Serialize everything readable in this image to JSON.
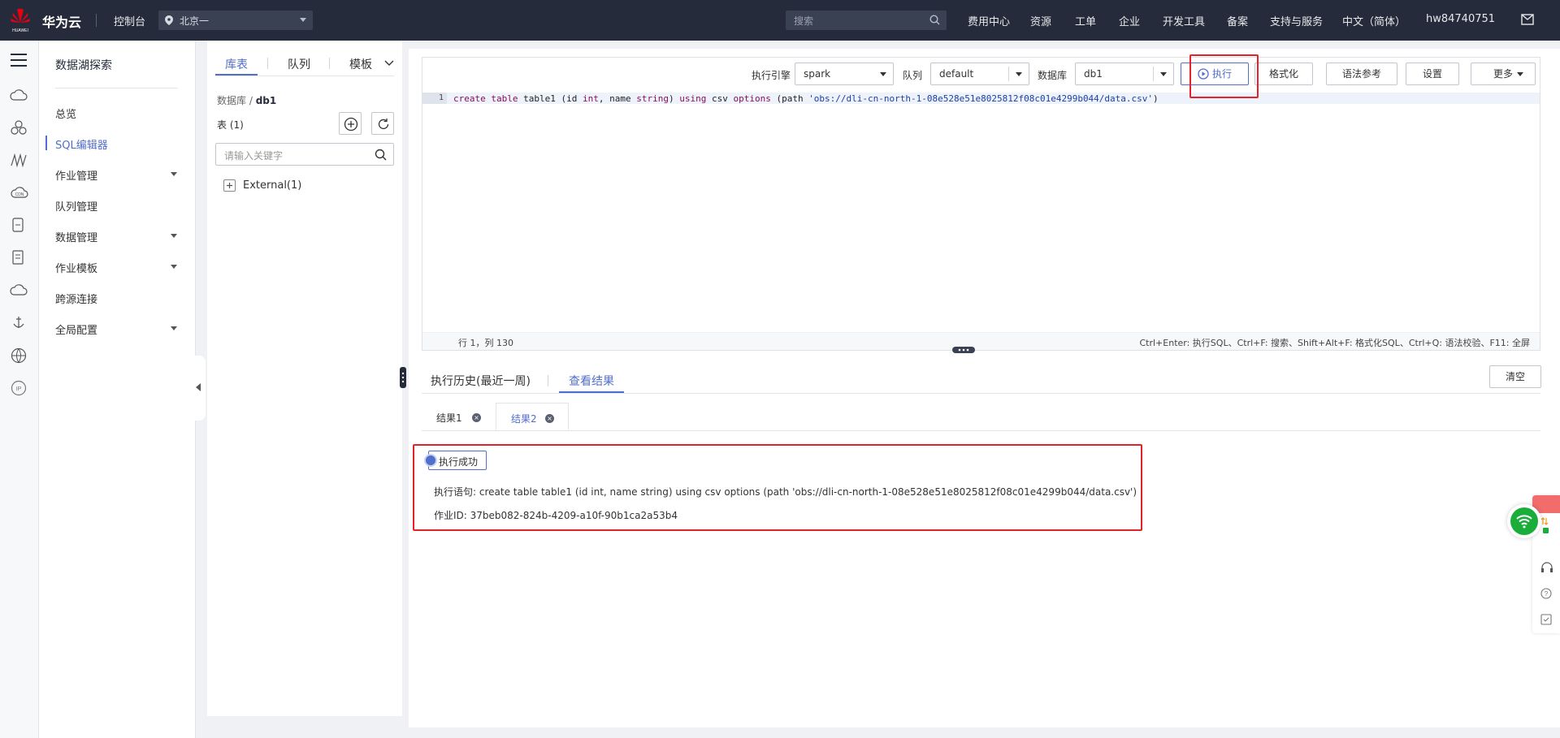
{
  "topbar": {
    "brand": "华为云",
    "console": "控制台",
    "region": "北京一",
    "search_placeholder": "搜索",
    "nav": [
      "费用中心",
      "资源",
      "工单",
      "企业",
      "开发工具",
      "备案",
      "支持与服务",
      "中文（简体）",
      "hw84740751"
    ]
  },
  "menu": {
    "title": "数据湖探索",
    "items": [
      {
        "label": "总览"
      },
      {
        "label": "SQL编辑器"
      },
      {
        "label": "作业管理"
      },
      {
        "label": "队列管理"
      },
      {
        "label": "数据管理"
      },
      {
        "label": "作业模板"
      },
      {
        "label": "跨源连接"
      },
      {
        "label": "全局配置"
      }
    ]
  },
  "catalog": {
    "tabs": [
      "库表",
      "队列",
      "模板"
    ],
    "breadcrumb_root": "数据库",
    "breadcrumb_db": "db1",
    "table_count": "表 (1)",
    "search_placeholder": "请输入关键字",
    "tree_node": "External(1)"
  },
  "toolbar": {
    "engine_label": "执行引擎",
    "engine_value": "spark",
    "queue_label": "队列",
    "queue_value": "default",
    "db_label": "数据库",
    "db_value": "db1",
    "run": "执行",
    "format": "格式化",
    "syntax": "语法参考",
    "settings": "设置",
    "more": "更多"
  },
  "editor": {
    "line_number": "1",
    "code_tokens": [
      {
        "t": "create",
        "c": "kw"
      },
      {
        "t": " ",
        "c": "plain"
      },
      {
        "t": "table",
        "c": "kw"
      },
      {
        "t": " table1 (id ",
        "c": "plain"
      },
      {
        "t": "int",
        "c": "kw"
      },
      {
        "t": ", name ",
        "c": "plain"
      },
      {
        "t": "string",
        "c": "kw"
      },
      {
        "t": ") ",
        "c": "plain"
      },
      {
        "t": "using",
        "c": "kw"
      },
      {
        "t": " csv ",
        "c": "plain"
      },
      {
        "t": "options",
        "c": "kw"
      },
      {
        "t": " (path ",
        "c": "plain"
      },
      {
        "t": "'obs://dli-cn-north-1-08e528e51e8025812f08c01e4299b044/data.csv'",
        "c": "str"
      },
      {
        "t": ")",
        "c": "plain"
      }
    ],
    "cursor_pos": "行 1，列 130",
    "shortcuts_hint": "Ctrl+Enter: 执行SQL、Ctrl+F: 搜索、Shift+Alt+F: 格式化SQL、Ctrl+Q: 语法校验、F11: 全屏"
  },
  "results": {
    "tabs": [
      "执行历史(最近一周)",
      "查看结果"
    ],
    "clear": "清空",
    "result_tabs": [
      "结果1",
      "结果2"
    ],
    "status": "执行成功",
    "statement": "执行语句: create table table1 (id int, name string) using csv options (path 'obs://dli-cn-north-1-08e528e51e8025812f08c01e4299b044/data.csv')",
    "job_id": "作业ID: 37beb082-824b-4209-a10f-90b1ca2a53b4"
  },
  "colors": {
    "topbar_bg": "#252b3a",
    "accent": "#526ecc",
    "highlight": "#e5222b"
  }
}
